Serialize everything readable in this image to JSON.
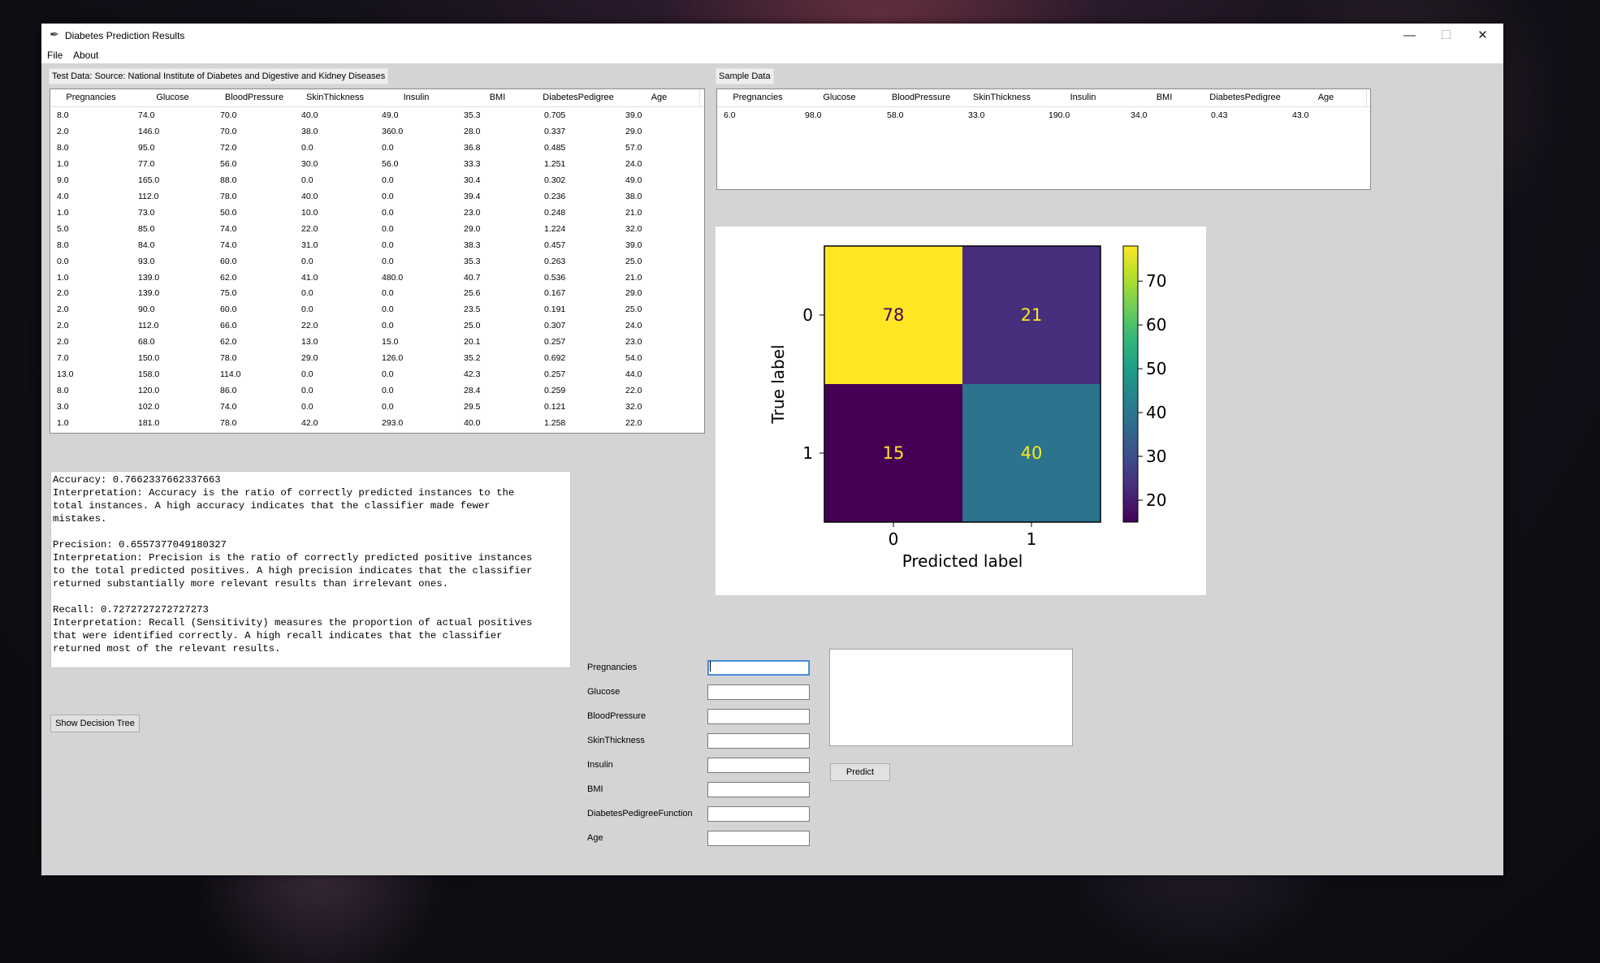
{
  "window": {
    "title": "Diabetes Prediction Results",
    "controls": {
      "minimize": "—",
      "maximize": "☐",
      "close": "✕"
    }
  },
  "menu": {
    "items": [
      "File",
      "About"
    ]
  },
  "test_table": {
    "label": "Test Data: Source: National Institute of Diabetes and Digestive and Kidney Diseases",
    "columns": [
      "Pregnancies",
      "Glucose",
      "BloodPressure",
      "SkinThickness",
      "Insulin",
      "BMI",
      "DiabetesPedigree",
      "Age"
    ],
    "rows": [
      [
        "8.0",
        "74.0",
        "70.0",
        "40.0",
        "49.0",
        "35.3",
        "0.705",
        "39.0"
      ],
      [
        "2.0",
        "146.0",
        "70.0",
        "38.0",
        "360.0",
        "28.0",
        "0.337",
        "29.0"
      ],
      [
        "8.0",
        "95.0",
        "72.0",
        "0.0",
        "0.0",
        "36.8",
        "0.485",
        "57.0"
      ],
      [
        "1.0",
        "77.0",
        "56.0",
        "30.0",
        "56.0",
        "33.3",
        "1.251",
        "24.0"
      ],
      [
        "9.0",
        "165.0",
        "88.0",
        "0.0",
        "0.0",
        "30.4",
        "0.302",
        "49.0"
      ],
      [
        "4.0",
        "112.0",
        "78.0",
        "40.0",
        "0.0",
        "39.4",
        "0.236",
        "38.0"
      ],
      [
        "1.0",
        "73.0",
        "50.0",
        "10.0",
        "0.0",
        "23.0",
        "0.248",
        "21.0"
      ],
      [
        "5.0",
        "85.0",
        "74.0",
        "22.0",
        "0.0",
        "29.0",
        "1.224",
        "32.0"
      ],
      [
        "8.0",
        "84.0",
        "74.0",
        "31.0",
        "0.0",
        "38.3",
        "0.457",
        "39.0"
      ],
      [
        "0.0",
        "93.0",
        "60.0",
        "0.0",
        "0.0",
        "35.3",
        "0.263",
        "25.0"
      ],
      [
        "1.0",
        "139.0",
        "62.0",
        "41.0",
        "480.0",
        "40.7",
        "0.536",
        "21.0"
      ],
      [
        "2.0",
        "139.0",
        "75.0",
        "0.0",
        "0.0",
        "25.6",
        "0.167",
        "29.0"
      ],
      [
        "2.0",
        "90.0",
        "60.0",
        "0.0",
        "0.0",
        "23.5",
        "0.191",
        "25.0"
      ],
      [
        "2.0",
        "112.0",
        "66.0",
        "22.0",
        "0.0",
        "25.0",
        "0.307",
        "24.0"
      ],
      [
        "2.0",
        "68.0",
        "62.0",
        "13.0",
        "15.0",
        "20.1",
        "0.257",
        "23.0"
      ],
      [
        "7.0",
        "150.0",
        "78.0",
        "29.0",
        "126.0",
        "35.2",
        "0.692",
        "54.0"
      ],
      [
        "13.0",
        "158.0",
        "114.0",
        "0.0",
        "0.0",
        "42.3",
        "0.257",
        "44.0"
      ],
      [
        "8.0",
        "120.0",
        "86.0",
        "0.0",
        "0.0",
        "28.4",
        "0.259",
        "22.0"
      ],
      [
        "3.0",
        "102.0",
        "74.0",
        "0.0",
        "0.0",
        "29.5",
        "0.121",
        "32.0"
      ],
      [
        "1.0",
        "181.0",
        "78.0",
        "42.0",
        "293.0",
        "40.0",
        "1.258",
        "22.0"
      ]
    ]
  },
  "sample_table": {
    "label": "Sample Data",
    "columns": [
      "Pregnancies",
      "Glucose",
      "BloodPressure",
      "SkinThickness",
      "Insulin",
      "BMI",
      "DiabetesPedigree",
      "Age"
    ],
    "rows": [
      [
        "6.0",
        "98.0",
        "58.0",
        "33.0",
        "190.0",
        "34.0",
        "0.43",
        "43.0"
      ]
    ]
  },
  "metrics_text": "Accuracy: 0.7662337662337663\nInterpretation: Accuracy is the ratio of correctly predicted instances to the\ntotal instances. A high accuracy indicates that the classifier made fewer\nmistakes.\n\nPrecision: 0.6557377049180327\nInterpretation: Precision is the ratio of correctly predicted positive instances\nto the total predicted positives. A high precision indicates that the classifier\nreturned substantially more relevant results than irrelevant ones.\n\nRecall: 0.7272727272727273\nInterpretation: Recall (Sensitivity) measures the proportion of actual positives\nthat were identified correctly. A high recall indicates that the classifier\nreturned most of the relevant results.",
  "buttons": {
    "show_tree": "Show Decision Tree",
    "predict": "Predict"
  },
  "form": {
    "fields": [
      {
        "label": "Pregnancies",
        "value": ""
      },
      {
        "label": "Glucose",
        "value": ""
      },
      {
        "label": "BloodPressure",
        "value": ""
      },
      {
        "label": "SkinThickness",
        "value": ""
      },
      {
        "label": "Insulin",
        "value": ""
      },
      {
        "label": "BMI",
        "value": ""
      },
      {
        "label": "DiabetesPedigreeFunction",
        "value": ""
      },
      {
        "label": "Age",
        "value": ""
      }
    ],
    "result_text": ""
  },
  "chart_data": {
    "type": "heatmap",
    "title": "",
    "xlabel": "Predicted label",
    "ylabel": "True label",
    "x_categories": [
      "0",
      "1"
    ],
    "y_categories": [
      "0",
      "1"
    ],
    "matrix": [
      [
        78,
        21
      ],
      [
        15,
        40
      ]
    ],
    "colormap": "viridis",
    "colorbar": {
      "ticks": [
        20,
        30,
        40,
        50,
        60,
        70
      ],
      "range": [
        15,
        78
      ]
    },
    "cell_text_colors": {
      "light_cells": "#440154",
      "dark_cells": "#fde725"
    },
    "cell_colors": {
      "78": "#fde725",
      "21": "#472f7d",
      "15": "#440154",
      "40": "#2c738e"
    }
  }
}
